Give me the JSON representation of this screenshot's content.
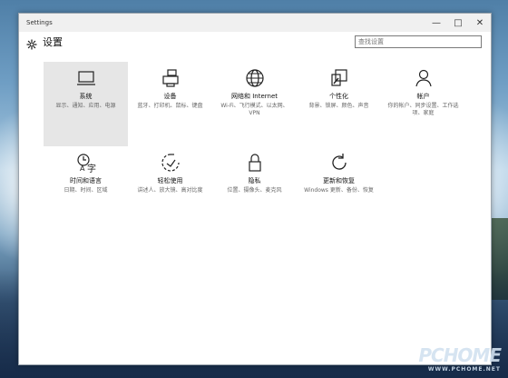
{
  "window": {
    "title": "Settings"
  },
  "header": {
    "title": "设置",
    "search_placeholder": "查找设置"
  },
  "tiles": [
    {
      "name": "系统",
      "desc": "显示、通知、应用、电源"
    },
    {
      "name": "设备",
      "desc": "蓝牙、打印机、鼠标、键盘"
    },
    {
      "name": "网络和 Internet",
      "desc": "Wi-Fi、飞行模式、以太网、VPN"
    },
    {
      "name": "个性化",
      "desc": "背景、锁屏、颜色、声音"
    },
    {
      "name": "帐户",
      "desc": "你的帐户、同步设置、工作选项、家庭"
    },
    {
      "name": "时间和语言",
      "desc": "日期、时间、区域"
    },
    {
      "name": "轻松使用",
      "desc": "讲述人、放大镜、高对比度"
    },
    {
      "name": "隐私",
      "desc": "位置、摄像头、麦克风"
    },
    {
      "name": "更新和恢复",
      "desc": "Windows 更新、备份、恢复"
    }
  ],
  "watermark": {
    "logo": "PCHOME",
    "sub": "WWW.PCHOME.NET"
  }
}
